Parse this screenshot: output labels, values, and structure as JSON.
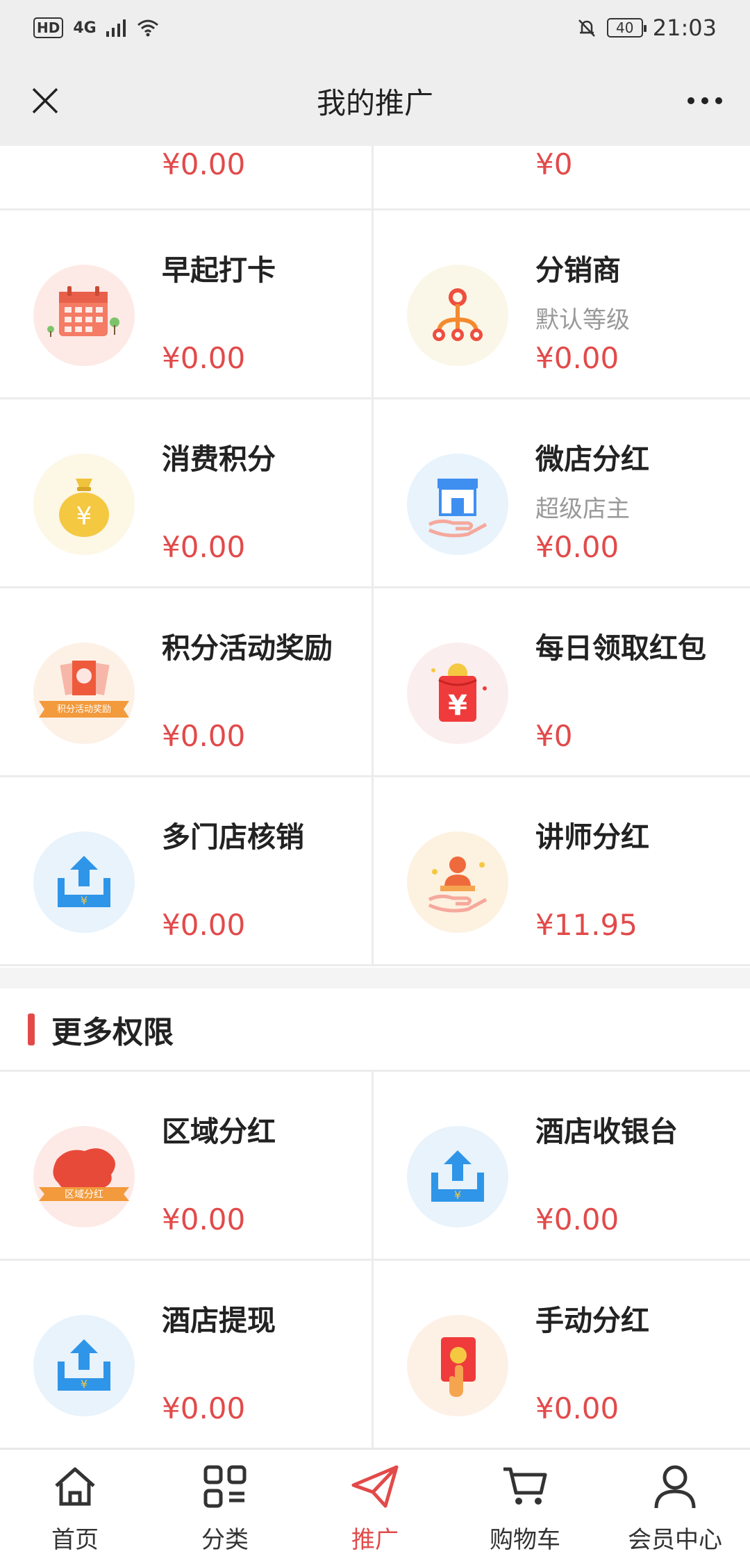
{
  "status_bar": {
    "hd": "HD",
    "network": "4G",
    "battery": "40",
    "time": "21:03"
  },
  "title_bar": {
    "title": "我的推广"
  },
  "partial_row": [
    {
      "value": "¥0.00"
    },
    {
      "value": "¥0"
    }
  ],
  "grid1": [
    {
      "title": "早起打卡",
      "subtitle": "",
      "value": "¥0.00",
      "icon": "calendar-icon"
    },
    {
      "title": "分销商",
      "subtitle": "默认等级",
      "value": "¥0.00",
      "icon": "distributor-tree-icon"
    },
    {
      "title": "消费积分",
      "subtitle": "",
      "value": "¥0.00",
      "icon": "money-bag-icon"
    },
    {
      "title": "微店分红",
      "subtitle": "超级店主",
      "value": "¥0.00",
      "icon": "shop-in-hand-icon"
    },
    {
      "title": "积分活动奖励",
      "subtitle": "",
      "value": "¥0.00",
      "icon": "points-reward-icon",
      "icon_text": "积分活动奖励"
    },
    {
      "title": "每日领取红包",
      "subtitle": "",
      "value": "¥0",
      "icon": "red-envelope-icon"
    },
    {
      "title": "多门店核销",
      "subtitle": "",
      "value": "¥0.00",
      "icon": "upload-tray-icon"
    },
    {
      "title": "讲师分红",
      "subtitle": "",
      "value": "¥11.95",
      "icon": "lecturer-icon"
    }
  ],
  "section": {
    "title": "更多权限"
  },
  "grid2": [
    {
      "title": "区域分红",
      "subtitle": "",
      "value": "¥0.00",
      "icon": "china-map-icon",
      "icon_text": "区域分红"
    },
    {
      "title": "酒店收银台",
      "subtitle": "",
      "value": "¥0.00",
      "icon": "upload-tray-icon"
    },
    {
      "title": "酒店提现",
      "subtitle": "",
      "value": "¥0.00",
      "icon": "upload-tray-icon"
    },
    {
      "title": "手动分红",
      "subtitle": "",
      "value": "¥0.00",
      "icon": "manual-envelope-icon"
    }
  ],
  "tab_bar": [
    {
      "label": "首页",
      "icon": "home-icon"
    },
    {
      "label": "分类",
      "icon": "category-icon"
    },
    {
      "label": "推广",
      "icon": "paper-plane-icon",
      "active": true
    },
    {
      "label": "购物车",
      "icon": "cart-icon"
    },
    {
      "label": "会员中心",
      "icon": "user-icon"
    }
  ],
  "colors": {
    "accent": "#e24a4a",
    "title_bar_bg": "#eeeeee",
    "text": "#222222",
    "muted": "#999999"
  }
}
